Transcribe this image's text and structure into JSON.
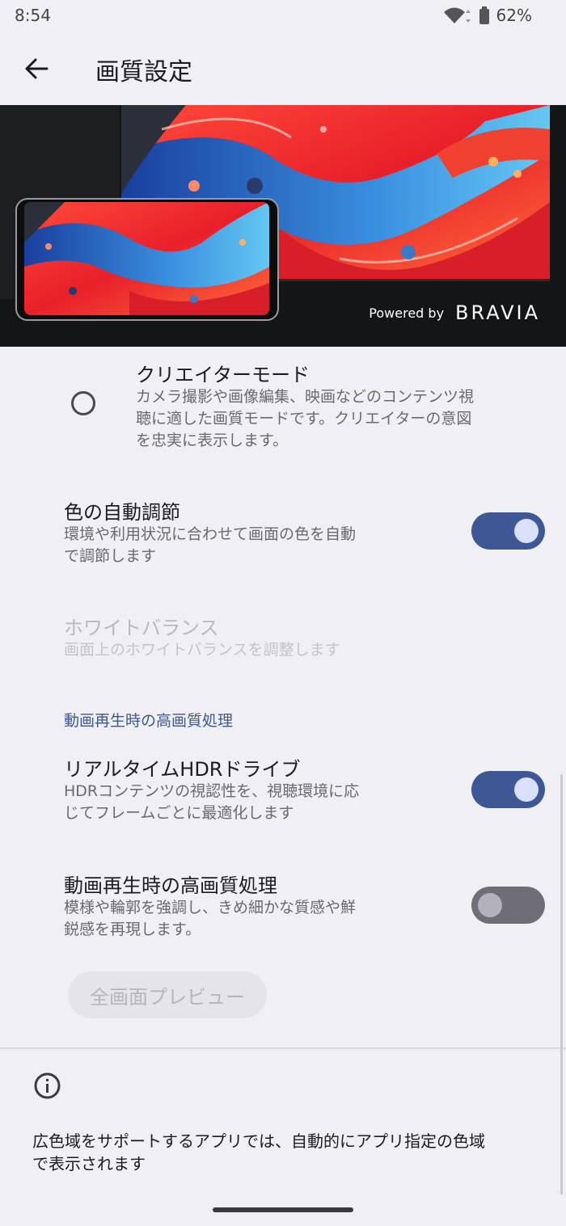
{
  "status_bar": {
    "time": "8:54",
    "battery": "62%"
  },
  "header": {
    "title": "画質設定"
  },
  "hero": {
    "powered_by": "Powered by",
    "brand": "BRAVIA"
  },
  "creator_mode": {
    "title": "クリエイターモード",
    "description_lines": [
      "カメラ撮影や画像編集、映画などのコンテンツ視",
      "聴に適した画質モードです。クリエイターの意図",
      "を忠実に表示します。"
    ],
    "selected": false
  },
  "auto_color": {
    "title": "色の自動調節",
    "description_lines": [
      "環境や利用状況に合わせて画面の色を自動",
      "で調節します"
    ],
    "enabled": true
  },
  "white_balance": {
    "title": "ホワイトバランス",
    "description": "画面上のホワイトバランスを調整します",
    "disabled": true
  },
  "section_video": {
    "header": "動画再生時の高画質処理"
  },
  "hdr_drive": {
    "title": "リアルタイムHDRドライブ",
    "description_lines": [
      "HDRコンテンツの視認性を、視聴環境に応",
      "じてフレームごとに最適化します"
    ],
    "enabled": true
  },
  "video_enhance": {
    "title": "動画再生時の高画質処理",
    "description_lines": [
      "模様や輪郭を強調し、きめ細かな質感や鮮",
      "鋭感を再現します。"
    ],
    "enabled": false
  },
  "preview_button": {
    "label": "全画面プレビュー"
  },
  "footer": {
    "text_lines": [
      "広色域をサポートするアプリでは、自動的にアプリ指定の色域",
      "で表示されます"
    ]
  },
  "colors": {
    "accent": "#3e5795",
    "background": "#f0eff4",
    "toggle_off": "#6f6e76"
  }
}
